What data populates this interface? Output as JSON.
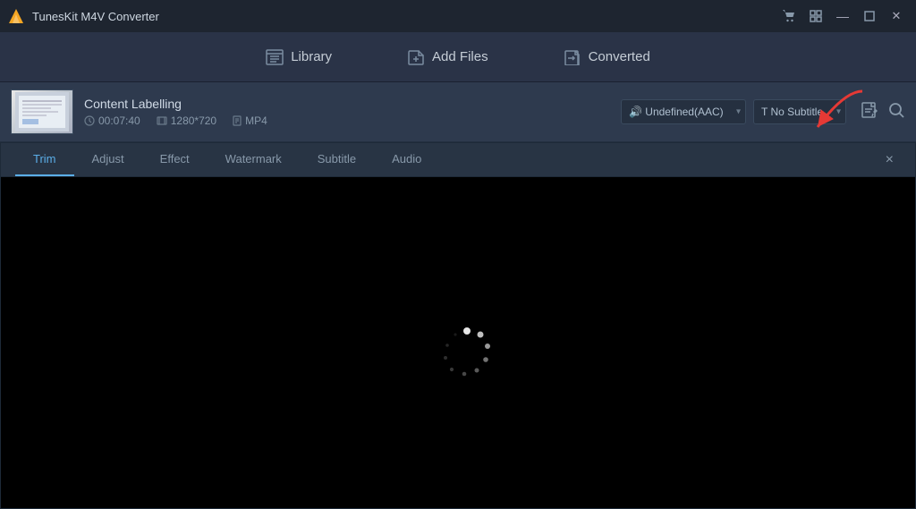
{
  "app": {
    "title": "TunesKit M4V Converter",
    "logo_color": "#f5a623"
  },
  "title_bar": {
    "controls": {
      "cart_icon": "🛒",
      "grid_icon": "⊞",
      "minimize": "—",
      "maximize": "□",
      "close": "✕"
    }
  },
  "nav": {
    "items": [
      {
        "id": "library",
        "label": "Library",
        "icon": "≡"
      },
      {
        "id": "add_files",
        "label": "Add Files",
        "icon": "📁"
      },
      {
        "id": "converted",
        "label": "Converted",
        "icon": "📤"
      }
    ]
  },
  "file": {
    "name": "Content Labelling",
    "duration": "00:07:40",
    "resolution": "1280*720",
    "format": "MP4",
    "audio": "Undefined(AAC)",
    "subtitle": "No Subtitle"
  },
  "panel": {
    "close_label": "×",
    "tabs": [
      {
        "id": "trim",
        "label": "Trim",
        "active": true
      },
      {
        "id": "adjust",
        "label": "Adjust"
      },
      {
        "id": "effect",
        "label": "Effect"
      },
      {
        "id": "watermark",
        "label": "Watermark"
      },
      {
        "id": "subtitle",
        "label": "Subtitle"
      },
      {
        "id": "audio",
        "label": "Audio"
      }
    ]
  },
  "colors": {
    "active_tab": "#5baee8",
    "bg_dark": "#1e2530",
    "bg_mid": "#2a3347",
    "bg_panel": "#283444",
    "red_arrow": "#e53935"
  }
}
